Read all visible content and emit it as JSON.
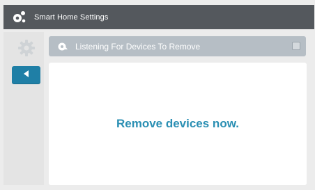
{
  "app": {
    "title": "Smart Home Settings",
    "icon": "smart-home-icon"
  },
  "nav": {
    "settings_icon": "gear-icon",
    "back_icon": "back-arrow-icon"
  },
  "panel": {
    "title": "Listening For Devices To Remove",
    "icon": "device-remove-icon",
    "message": "Remove devices now."
  },
  "colors": {
    "topbar": "#54585d",
    "accent": "#1f7fa6",
    "header": "#b6bec5",
    "message": "#2a8fb3"
  }
}
